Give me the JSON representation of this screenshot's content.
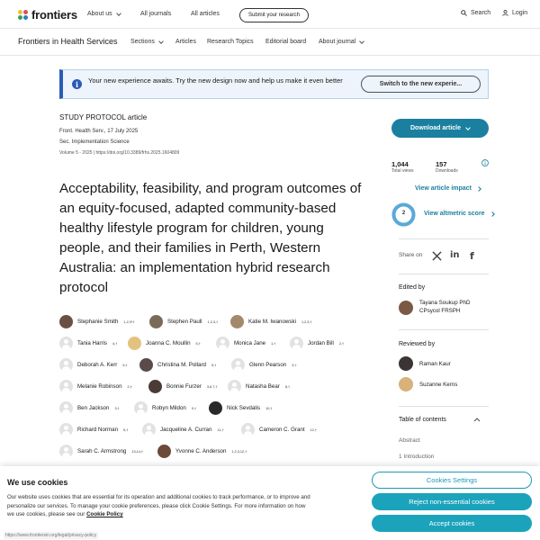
{
  "header": {
    "logo": "frontiers",
    "nav": [
      "About us",
      "All journals",
      "All articles"
    ],
    "submit": "Submit your research",
    "search": "Search",
    "login": "Login"
  },
  "subheader": {
    "journal": "Frontiers in Health Services",
    "nav": [
      "Sections",
      "Articles",
      "Research Topics",
      "Editorial board",
      "About journal"
    ]
  },
  "banner": {
    "text": "Your new experience awaits. Try the new design now and help us make it even better",
    "button": "Switch to the new experie..."
  },
  "article": {
    "type": "STUDY PROTOCOL article",
    "journal_line": "Front. Health Serv., 17 July 2025",
    "section_line": "Sec. Implementation Science",
    "doi_line": "Volume 5 - 2025 | https://doi.org/10.3389/frhs.2025.1604809",
    "title": "Acceptability, feasibility, and program outcomes of an equity-focused, adapted community-based healthy lifestyle program for children, young people, and their families in Perth, Western Australia: an implementation hybrid research protocol"
  },
  "authors": [
    {
      "name": "Stephanie Smith",
      "sup": "1,2,3*†",
      "photo": true,
      "color": "#6b4f45"
    },
    {
      "name": "Stephen Paull",
      "sup": "1,2,3,†",
      "photo": true,
      "color": "#7a6a5a"
    },
    {
      "name": "Katie M. Iwanowski",
      "sup": "1,2,3,†",
      "photo": true,
      "color": "#a3886a"
    },
    {
      "name": "Tania Harris",
      "sup": "4,†",
      "photo": false
    },
    {
      "name": "Joanna C. Moullin",
      "sup": "5,†",
      "photo": true,
      "color": "#e3c27e"
    },
    {
      "name": "Monica Jane",
      "sup": "1,†",
      "photo": false
    },
    {
      "name": "Jordan Bill",
      "sup": "2,†",
      "photo": false
    },
    {
      "name": "Deborah A. Kerr",
      "sup": "5,†",
      "photo": false
    },
    {
      "name": "Christina M. Pollard",
      "sup": "5,†",
      "photo": true,
      "color": "#5a4a4a"
    },
    {
      "name": "Glenn Pearson",
      "sup": "3,†",
      "photo": false
    },
    {
      "name": "Melanie Robinson",
      "sup": "2,†",
      "photo": false
    },
    {
      "name": "Bonnie Furzer",
      "sup": "3,6,7,†",
      "photo": true,
      "color": "#4b3b36"
    },
    {
      "name": "Natasha Bear",
      "sup": "8,†",
      "photo": false
    },
    {
      "name": "Ben Jackson",
      "sup": "3,†",
      "photo": false
    },
    {
      "name": "Robyn Mildon",
      "sup": "9,†",
      "photo": false
    },
    {
      "name": "Nick Sevdalis",
      "sup": "10,†",
      "photo": true,
      "color": "#2a2a2a"
    },
    {
      "name": "Richard Norman",
      "sup": "5,†",
      "photo": false
    },
    {
      "name": "Jacqueline A. Curran",
      "sup": "11,†",
      "photo": false
    },
    {
      "name": "Cameron C. Grant",
      "sup": "12,†",
      "photo": false
    },
    {
      "name": "Sarah C. Armstrong",
      "sup": "13,14,†",
      "photo": false
    },
    {
      "name": "Yvonne C. Anderson",
      "sup": "1,2,3,12,†",
      "photo": true,
      "color": "#6b4a3a"
    }
  ],
  "sidebar": {
    "download": "Download article",
    "views_num": "1,044",
    "views_lbl": "Total views",
    "downloads_num": "157",
    "downloads_lbl": "Downloads",
    "impact": "View article impact",
    "altmetric_score": "2",
    "altmetric": "View altmetric score",
    "share": "Share on",
    "edited_by": "Edited by",
    "editor": "Tayana Soukup PhD CPsycol FRSPH",
    "reviewed_by": "Reviewed by",
    "reviewers": [
      "Raman Kaur",
      "Suzanne Kerns"
    ],
    "toc_title": "Table of contents",
    "toc": [
      "Abstract",
      "1 Introduction"
    ]
  },
  "cookie": {
    "title": "We use cookies",
    "text": "Our website uses cookies that are essential for its operation and additional cookies to track performance, or to improve and personalize our services. To manage your cookie preferences, please click Cookie Settings. For more information on how we use cookies, please see our",
    "policy": "Cookie Policy",
    "settings": "Cookies Settings",
    "reject": "Reject non-essential cookies",
    "accept": "Accept cookies"
  },
  "status_url": "https://www.frontiersin.org/legal/privacy-policy",
  "colors": {
    "accent": "#1b7fa0",
    "banner_accent": "#2a5bb5"
  }
}
